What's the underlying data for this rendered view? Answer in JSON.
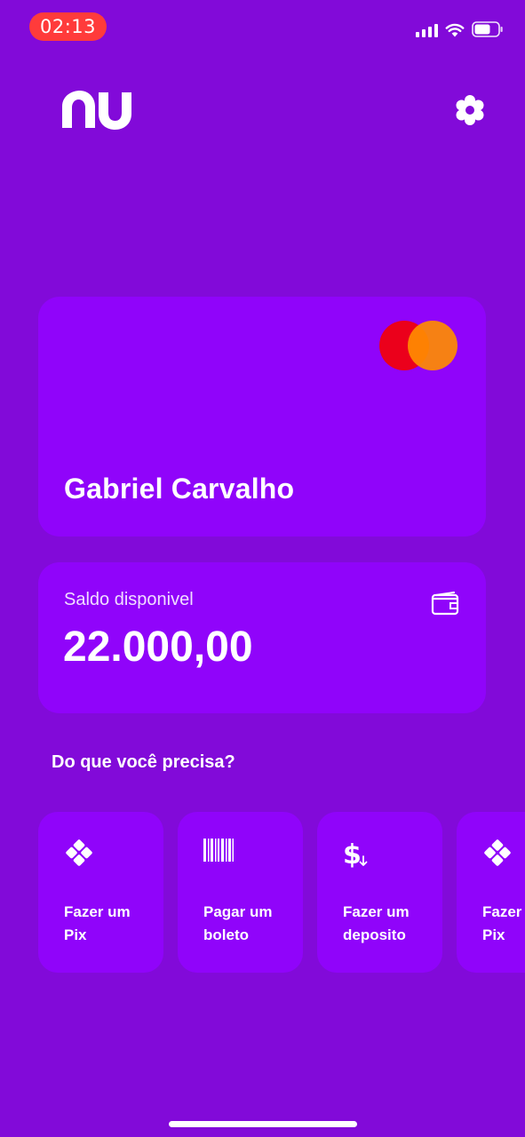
{
  "status_bar": {
    "time": "02:13",
    "time_bg": "#ff3b3b"
  },
  "header": {
    "logo_text": "nu",
    "settings_icon": "gear-icon"
  },
  "card": {
    "holder_name": "Gabriel Carvalho",
    "brand_icon": "mastercard-logo"
  },
  "balance": {
    "label": "Saldo disponivel",
    "value": "22.000,00",
    "icon": "wallet-icon"
  },
  "actions": {
    "title": "Do que você precisa?",
    "items": [
      {
        "line1": "Fazer um",
        "line2": "Pix",
        "icon": "pix-icon"
      },
      {
        "line1": "Pagar um",
        "line2": "boleto",
        "icon": "barcode-icon"
      },
      {
        "line1": "Fazer um",
        "line2": "deposito",
        "icon": "dollar-deposit-icon"
      },
      {
        "line1": "Fazer",
        "line2": "Pix",
        "icon": "pix-icon"
      }
    ]
  },
  "colors": {
    "background": "#820ad9",
    "surface": "#9004fa",
    "mastercard_red": "#eb001b",
    "mastercard_orange": "#ff8c00"
  }
}
